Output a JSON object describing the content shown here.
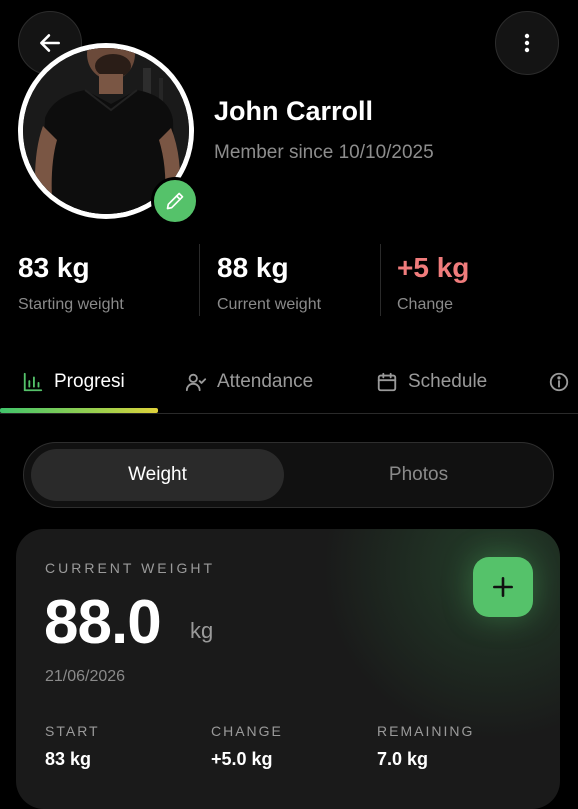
{
  "profile": {
    "name": "John Carroll",
    "member_since": "Member since 10/10/2025"
  },
  "stats": [
    {
      "value": "83 kg",
      "label": "Starting weight"
    },
    {
      "value": "88 kg",
      "label": "Current weight"
    },
    {
      "value": "+5 kg",
      "label": "Change"
    }
  ],
  "tabs": [
    {
      "label": "Progresi",
      "icon": "bar-chart-icon",
      "active": true
    },
    {
      "label": "Attendance",
      "icon": "user-check-icon",
      "active": false
    },
    {
      "label": "Schedule",
      "icon": "calendar-icon",
      "active": false
    },
    {
      "label": "",
      "icon": "info-icon",
      "active": false
    }
  ],
  "segment": {
    "weight": "Weight",
    "photos": "Photos",
    "selected": "Weight"
  },
  "card": {
    "title": "CURRENT WEIGHT",
    "value": "88.0",
    "unit": "kg",
    "date": "21/06/2026",
    "start_label": "START",
    "start_value": "83 kg",
    "change_label": "CHANGE",
    "change_value": "+5.0 kg",
    "remaining_label": "REMAINING",
    "remaining_value": "7.0 kg"
  },
  "colors": {
    "accent": "#55c26a",
    "change": "#f07c7c",
    "background": "#000000"
  }
}
